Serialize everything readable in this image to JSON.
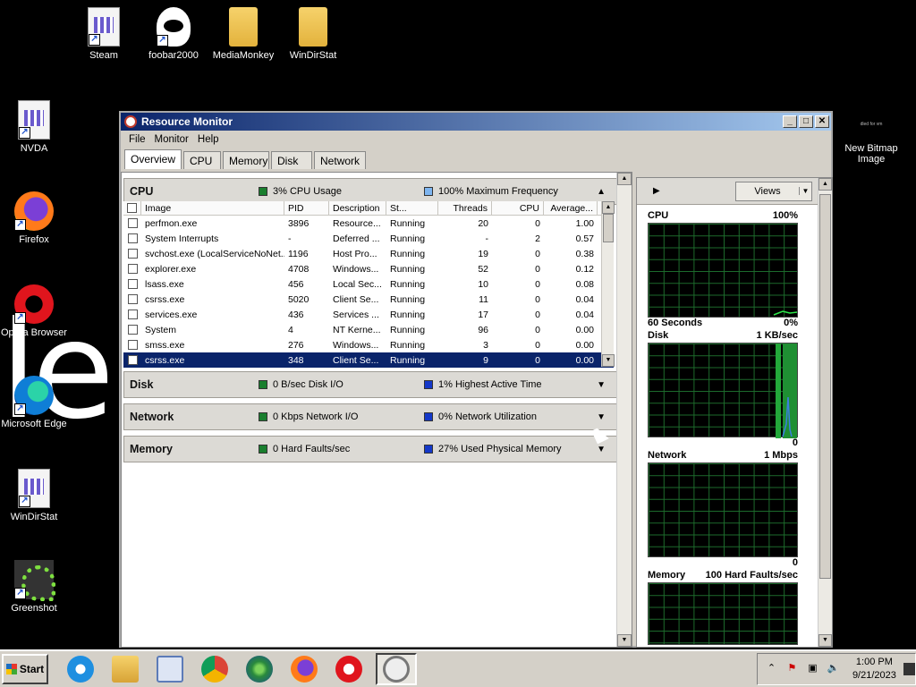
{
  "desktop": {
    "wallpaper_text": "le",
    "icons": [
      "Steam",
      "foobar2000",
      "MediaMonkey",
      "WinDirStat",
      "NVDA",
      "Firefox",
      "Opera Browser",
      "Microsoft Edge",
      "WinDirStat",
      "Greenshot"
    ],
    "bitmap": {
      "tiny": "dled for vm",
      "label": "New Bitmap Image"
    }
  },
  "window": {
    "title": "Resource Monitor",
    "menu": [
      "File",
      "Monitor",
      "Help"
    ],
    "tabs": [
      "Overview",
      "CPU",
      "Memory",
      "Disk",
      "Network"
    ],
    "active_tab": "Overview"
  },
  "cpu": {
    "name": "CPU",
    "stat1": "3% CPU Usage",
    "stat2": "100% Maximum Frequency",
    "columns": [
      "Image",
      "PID",
      "Description",
      "St...",
      "Threads",
      "CPU",
      "Average..."
    ],
    "rows": [
      [
        "perfmon.exe",
        "3896",
        "Resource...",
        "Running",
        "20",
        "0",
        "1.00"
      ],
      [
        "System Interrupts",
        "-",
        "Deferred ...",
        "Running",
        "-",
        "2",
        "0.57"
      ],
      [
        "svchost.exe (LocalServiceNoNet...",
        "1196",
        "Host Pro...",
        "Running",
        "19",
        "0",
        "0.38"
      ],
      [
        "explorer.exe",
        "4708",
        "Windows...",
        "Running",
        "52",
        "0",
        "0.12"
      ],
      [
        "lsass.exe",
        "456",
        "Local Sec...",
        "Running",
        "10",
        "0",
        "0.08"
      ],
      [
        "csrss.exe",
        "5020",
        "Client Se...",
        "Running",
        "11",
        "0",
        "0.04"
      ],
      [
        "services.exe",
        "436",
        "Services ...",
        "Running",
        "17",
        "0",
        "0.04"
      ],
      [
        "System",
        "4",
        "NT Kerne...",
        "Running",
        "96",
        "0",
        "0.00"
      ],
      [
        "smss.exe",
        "276",
        "Windows...",
        "Running",
        "3",
        "0",
        "0.00"
      ],
      [
        "csrss.exe",
        "348",
        "Client Se...",
        "Running",
        "9",
        "0",
        "0.00"
      ]
    ]
  },
  "disk": {
    "name": "Disk",
    "stat1": "0 B/sec Disk I/O",
    "stat2": "1% Highest Active Time"
  },
  "network": {
    "name": "Network",
    "stat1": "0 Kbps Network I/O",
    "stat2": "0% Network Utilization"
  },
  "memory": {
    "name": "Memory",
    "stat1": "0 Hard Faults/sec",
    "stat2": "27% Used Physical Memory"
  },
  "right": {
    "views_label": "Views",
    "cpu_graph": {
      "title": "CPU",
      "max": "100%",
      "footer_left": "60 Seconds",
      "footer_right": "0%"
    },
    "disk_graph": {
      "title": "Disk",
      "max": "1 KB/sec",
      "footer_right": "0"
    },
    "network_graph": {
      "title": "Network",
      "max": "1 Mbps",
      "footer_right": "0"
    },
    "memory_graph": {
      "title": "Memory",
      "max": "100 Hard Faults/sec"
    }
  },
  "taskbar": {
    "start_label": "Start",
    "time": "1:00 PM",
    "date": "9/21/2023"
  },
  "colors": {
    "title_start": "#0a246a",
    "graph_grid": "#1d6b2c",
    "graph_line": "#2ee84a",
    "selection": "#0a246a"
  }
}
